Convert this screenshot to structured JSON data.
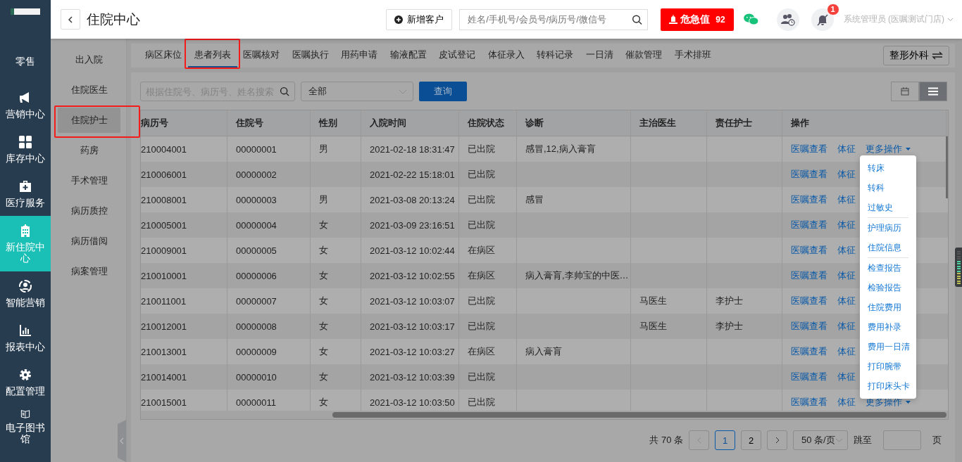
{
  "nav": [
    {
      "label": "零售",
      "kind": "text",
      "selected": false
    },
    {
      "label": "营销中心",
      "kind": "megaphone",
      "selected": false
    },
    {
      "label": "库存中心",
      "kind": "grid",
      "selected": false
    },
    {
      "label": "医疗服务",
      "kind": "medkit",
      "selected": false
    },
    {
      "label": "新住院中心",
      "kind": "hospital",
      "selected": true
    },
    {
      "label": "智能营销",
      "kind": "people",
      "selected": false
    },
    {
      "label": "报表中心",
      "kind": "chart",
      "selected": false
    },
    {
      "label": "配置管理",
      "kind": "gear",
      "selected": false
    },
    {
      "label": "电子图书馆",
      "kind": "book",
      "selected": false
    }
  ],
  "header": {
    "title": "住院中心",
    "new_customer": "新增客户",
    "search_placeholder": "姓名/手机号/会员号/病历号/微信号",
    "alert_label": "危急值",
    "alert_count": "92",
    "notification_count": "1",
    "user": "系统管理员 (医嘱测试门店)"
  },
  "subnav": [
    {
      "label": "出入院",
      "selected": false,
      "highlighted": false
    },
    {
      "label": "住院医生",
      "selected": false,
      "highlighted": false
    },
    {
      "label": "住院护士",
      "selected": true,
      "highlighted": true
    },
    {
      "label": "药房",
      "selected": false,
      "highlighted": false
    },
    {
      "label": "手术管理",
      "selected": false,
      "highlighted": false
    },
    {
      "label": "病历质控",
      "selected": false,
      "highlighted": false
    },
    {
      "label": "病历借阅",
      "selected": false,
      "highlighted": false
    },
    {
      "label": "病案管理",
      "selected": false,
      "highlighted": false
    }
  ],
  "tabs": [
    {
      "label": "病区床位",
      "selected": false,
      "highlighted": false
    },
    {
      "label": "患者列表",
      "selected": true,
      "highlighted": true
    },
    {
      "label": "医嘱核对",
      "selected": false,
      "highlighted": false
    },
    {
      "label": "医嘱执行",
      "selected": false,
      "highlighted": false
    },
    {
      "label": "用药申请",
      "selected": false,
      "highlighted": false
    },
    {
      "label": "输液配置",
      "selected": false,
      "highlighted": false
    },
    {
      "label": "皮试登记",
      "selected": false,
      "highlighted": false
    },
    {
      "label": "体征录入",
      "selected": false,
      "highlighted": false
    },
    {
      "label": "转科记录",
      "selected": false,
      "highlighted": false
    },
    {
      "label": "一日清",
      "selected": false,
      "highlighted": false
    },
    {
      "label": "催款管理",
      "selected": false,
      "highlighted": false
    },
    {
      "label": "手术排班",
      "selected": false,
      "highlighted": false
    }
  ],
  "department": "整形外科",
  "filter": {
    "placeholder": "根据住院号、病历号、姓名搜索",
    "status": "全部",
    "query": "查询"
  },
  "view_toggle": [
    {
      "kind": "calendar",
      "selected": false
    },
    {
      "kind": "list",
      "selected": true
    }
  ],
  "table": {
    "columns": [
      "病历号",
      "住院号",
      "性别",
      "入院时间",
      "住院状态",
      "诊断",
      "主治医生",
      "责任护士",
      "操作"
    ],
    "rows": [
      {
        "cells": [
          "210004001",
          "00000001",
          "男",
          "2021-02-18 18:31:47",
          "已出院",
          "感冒,12,病入膏肓",
          "",
          ""
        ],
        "actions": [
          "医嘱查看",
          "体征",
          "更多操作"
        ]
      },
      {
        "cells": [
          "210006001",
          "00000002",
          "",
          "2021-02-22 15:18:01",
          "已出院",
          "",
          "",
          ""
        ],
        "actions": [
          "医嘱查看",
          "体征"
        ]
      },
      {
        "cells": [
          "210008001",
          "00000003",
          "男",
          "2021-03-08 20:13:24",
          "已出院",
          "感冒",
          "",
          ""
        ],
        "actions": [
          "医嘱查看",
          "体征"
        ]
      },
      {
        "cells": [
          "210005001",
          "00000004",
          "女",
          "2021-03-09 23:16:51",
          "已出院",
          "",
          "",
          ""
        ],
        "actions": [
          "医嘱查看",
          "体征"
        ]
      },
      {
        "cells": [
          "210009001",
          "00000005",
          "女",
          "2021-03-12 10:02:44",
          "在病区",
          "",
          "",
          ""
        ],
        "actions": [
          "医嘱查看",
          "体征"
        ]
      },
      {
        "cells": [
          "210010001",
          "00000006",
          "女",
          "2021-03-12 10:02:55",
          "在病区",
          "病入膏肓,李帅宝的中医…",
          "",
          ""
        ],
        "actions": [
          "医嘱查看",
          "体征"
        ]
      },
      {
        "cells": [
          "210011001",
          "00000007",
          "女",
          "2021-03-12 10:03:07",
          "已出院",
          "",
          "马医生",
          "李护士"
        ],
        "actions": [
          "医嘱查看",
          "体征"
        ]
      },
      {
        "cells": [
          "210012001",
          "00000008",
          "女",
          "2021-03-12 10:03:17",
          "已出院",
          "",
          "马医生",
          "李护士"
        ],
        "actions": [
          "医嘱查看",
          "体征"
        ]
      },
      {
        "cells": [
          "210013001",
          "00000009",
          "女",
          "2021-03-12 10:03:27",
          "在病区",
          "病入膏肓",
          "",
          ""
        ],
        "actions": [
          "医嘱查看",
          "体征"
        ]
      },
      {
        "cells": [
          "210014001",
          "00000010",
          "女",
          "2021-03-12 10:03:39",
          "已出院",
          "",
          "",
          ""
        ],
        "actions": [
          "医嘱查看",
          "体征"
        ]
      },
      {
        "cells": [
          "210015001",
          "00000011",
          "女",
          "2021-03-12 10:03:50",
          "已出院",
          "",
          "",
          ""
        ],
        "actions": [
          "医嘱查看",
          "体征",
          "更多操作"
        ]
      }
    ]
  },
  "dropdown": [
    [
      "转床",
      "转科",
      "过敏史"
    ],
    [
      "护理病历",
      "住院信息"
    ],
    [
      "检查报告",
      "检验报告",
      "住院费用",
      "费用补录",
      "费用一日清",
      "打印腕带",
      "打印床头卡"
    ]
  ],
  "pagination": {
    "total": "共 70 条",
    "pages": [
      {
        "label": "1",
        "selected": true
      },
      {
        "label": "2",
        "selected": false
      }
    ],
    "page_size": "50 条/页",
    "jump": "跳至",
    "unit": "页"
  }
}
